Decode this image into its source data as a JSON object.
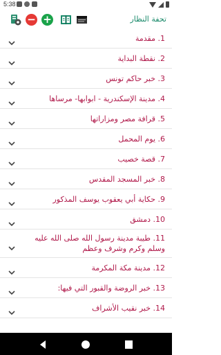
{
  "status_bar": {
    "time": "5:38"
  },
  "toolbar": {
    "title": "تحفة النظار",
    "icons": [
      "settings-icon",
      "minus-icon",
      "plus-icon",
      "book-icon",
      "window-icon"
    ]
  },
  "colors": {
    "accent": "#1b8a6b",
    "item_text": "#b0194a",
    "remove": "#e53935",
    "add": "#1aa34a"
  },
  "list": {
    "items": [
      {
        "label": "1. مقدمة"
      },
      {
        "label": "2. نقطة البداية"
      },
      {
        "label": "3. خبر حاكم تونس"
      },
      {
        "label": "4. مدينة الإسكندرية - ابوابها- مرساها"
      },
      {
        "label": "5. قرافة مصر ومزاراتها"
      },
      {
        "label": "6. يوم المحمل"
      },
      {
        "label": "7. قصة خصيب"
      },
      {
        "label": "8. خبر المسجد المقدس"
      },
      {
        "label": "9. حكاية أبي يعقوب يوسف المذكور"
      },
      {
        "label": "10. دمشق"
      },
      {
        "label": "11. طيبة مدينة رسول الله صلى الله عليه وسلم وكرم وشرف وعظم"
      },
      {
        "label": "12. مدينة مكة المكرمة"
      },
      {
        "label": "13. خبر الروضة والقبور التي فيها:"
      },
      {
        "label": "14. خبر نقيب الأشراف"
      }
    ]
  }
}
